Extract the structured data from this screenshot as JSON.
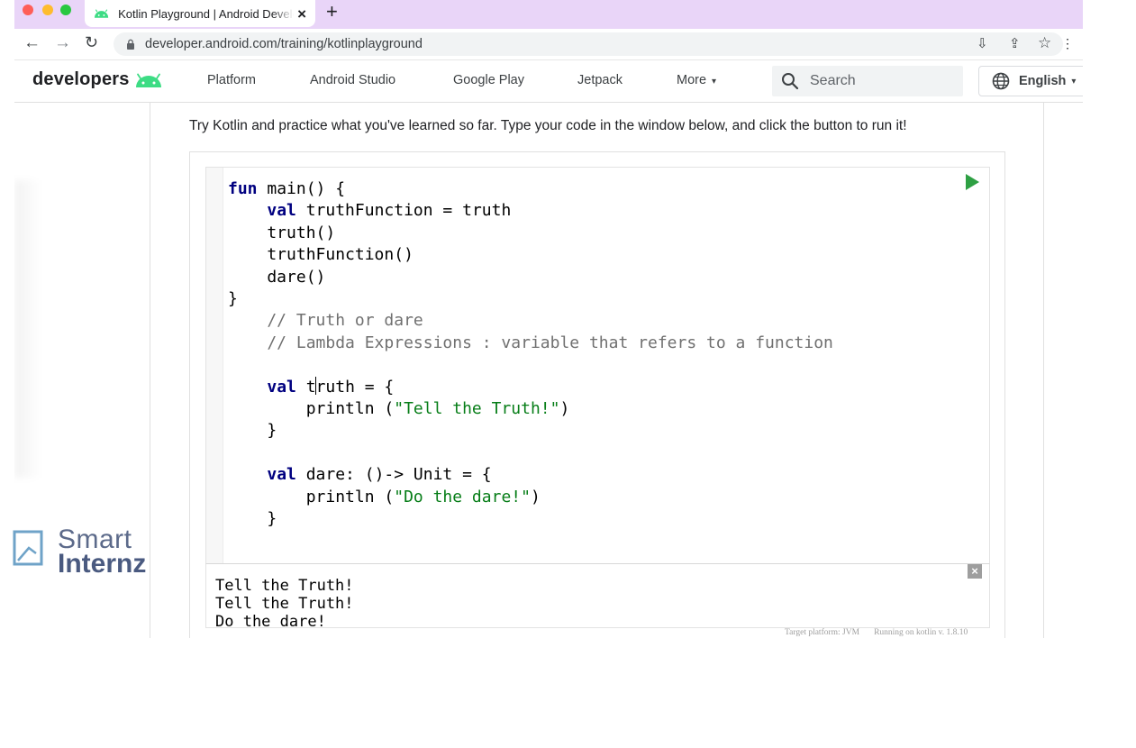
{
  "browser": {
    "tab_title": "Kotlin Playground | Android Developers",
    "tab_close": "×",
    "new_tab": "+",
    "url": "developer.android.com/training/kotlinplayground"
  },
  "site": {
    "logo_text": "developers",
    "nav": [
      "Platform",
      "Android Studio",
      "Google Play",
      "Jetpack",
      "More"
    ],
    "search_placeholder": "Search",
    "language": "English",
    "accent_color": "#3ddc84"
  },
  "content": {
    "intro": "Try Kotlin and practice what you've learned so far. Type your code in the window below, and click the button to run it!"
  },
  "playground": {
    "code": {
      "l1_kw": "fun",
      "l1_rest": " main() {",
      "l2_kw": "val",
      "l2_rest": " truthFunction = truth",
      "l3": "    truth()",
      "l4": "    truthFunction()",
      "l5": "    dare()",
      "l6": "}",
      "l7": "    // Truth or dare",
      "l8": "    // Lambda Expressions : variable that refers to a function",
      "l10_kw": "val",
      "l10_a": " t",
      "l10_b": "ruth = {",
      "l11_pre": "        println (",
      "l11_str": "\"Tell the Truth!\"",
      "l11_post": ")",
      "l12": "    }",
      "l14_kw": "val",
      "l14_rest": " dare: ()-> Unit = {",
      "l15_pre": "        println (",
      "l15_str": "\"Do the dare!\"",
      "l15_post": ")",
      "l16": "    }"
    },
    "output": "Tell the Truth!\nTell the Truth!\nDo the dare!",
    "target_platform": "Target platform: JVM",
    "running_on": "Running on kotlin v. 1.8.10"
  },
  "watermark": {
    "line1": "Smart",
    "line2": "Internz"
  },
  "icons": {
    "back": "←",
    "forward": "→",
    "reload": "↻",
    "install": "⇩",
    "share": "⇪",
    "star": "☆",
    "extensions": "⋮",
    "more_caret": "▾",
    "output_close": "×"
  }
}
